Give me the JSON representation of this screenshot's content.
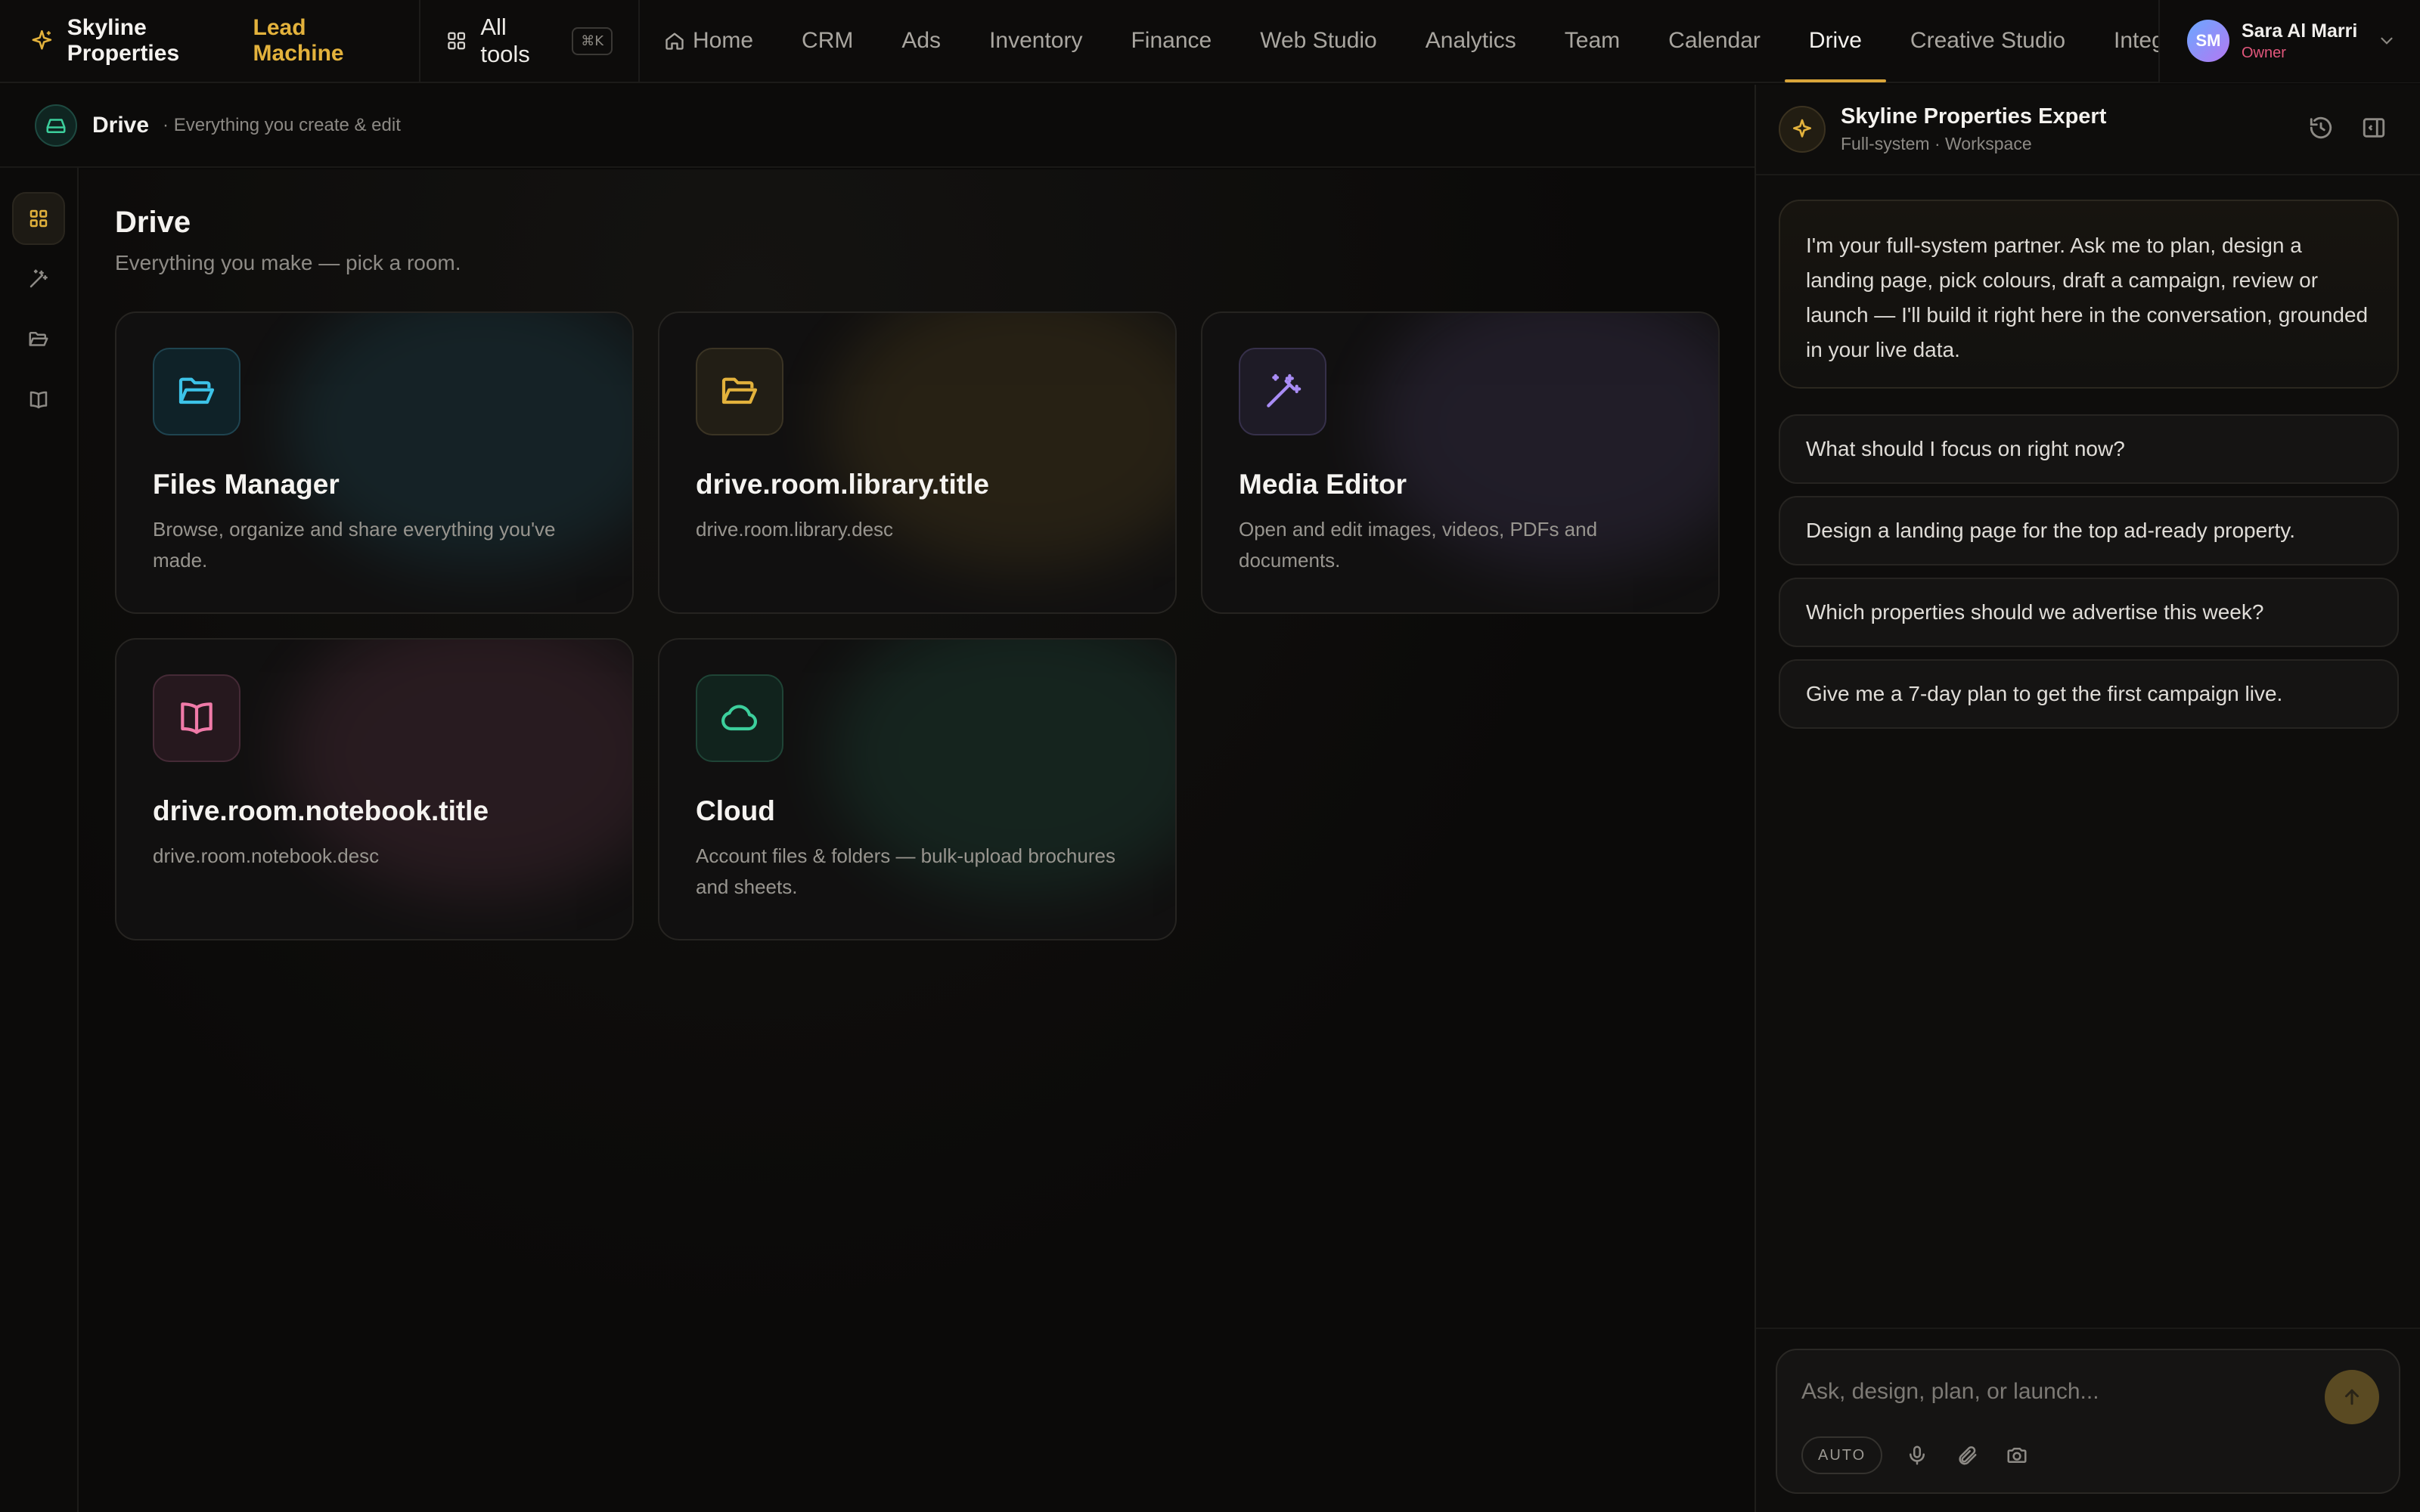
{
  "header": {
    "brand_name": "Skyline Properties",
    "brand_accent": "Lead Machine",
    "all_tools_label": "All tools",
    "all_tools_shortcut": "⌘K",
    "nav": [
      {
        "label": "Home",
        "icon": "home-icon"
      },
      {
        "label": "CRM"
      },
      {
        "label": "Ads"
      },
      {
        "label": "Inventory"
      },
      {
        "label": "Finance"
      },
      {
        "label": "Web Studio"
      },
      {
        "label": "Analytics"
      },
      {
        "label": "Team"
      },
      {
        "label": "Calendar"
      },
      {
        "label": "Drive",
        "active": true
      },
      {
        "label": "Creative Studio"
      },
      {
        "label": "Integ"
      }
    ],
    "user": {
      "initials": "SM",
      "name": "Sara Al Marri",
      "role": "Owner"
    }
  },
  "subheader": {
    "title": "Drive",
    "description": "· Everything you create & edit"
  },
  "rail": {
    "items": [
      {
        "icon": "grid-icon",
        "active": true
      },
      {
        "icon": "magic-wand-icon"
      },
      {
        "icon": "folder-open-icon"
      },
      {
        "icon": "book-open-icon"
      }
    ]
  },
  "main": {
    "title": "Drive",
    "subtitle": "Everything you make — pick a room.",
    "rooms": [
      {
        "title": "Files Manager",
        "description": "Browse, organize and share everything you've made.",
        "icon": "folder-open-icon",
        "accent": "#3cc3e8"
      },
      {
        "title": "drive.room.library.title",
        "description": "drive.room.library.desc",
        "icon": "folder-open-icon",
        "accent": "#e3b23c"
      },
      {
        "title": "Media Editor",
        "description": "Open and edit images, videos, PDFs and documents.",
        "icon": "magic-wand-icon",
        "accent": "#a98cf5"
      },
      {
        "title": "drive.room.notebook.title",
        "description": "drive.room.notebook.desc",
        "icon": "book-open-icon",
        "accent": "#f07aa8"
      },
      {
        "title": "Cloud",
        "description": "Account files & folders — bulk-upload brochures and sheets.",
        "icon": "cloud-icon",
        "accent": "#3ccf9c"
      }
    ]
  },
  "assistant": {
    "name": "Skyline Properties Expert",
    "subtitle": "Full-system · Workspace",
    "intro": "I'm your full-system partner. Ask me to plan, design a landing page, pick colours, draft a campaign, review or launch — I'll build it right here in the conversation, grounded in your live data.",
    "suggestions": [
      "What should I focus on right now?",
      "Design a landing page for the top ad-ready property.",
      "Which properties should we advertise this week?",
      "Give me a 7-day plan to get the first campaign live."
    ],
    "composer_placeholder": "Ask, design, plan, or launch...",
    "mode_chip": "AUTO"
  },
  "colors": {
    "accent": "#e3b23c",
    "background": "#0b0a09",
    "owner_role": "#e2577c"
  }
}
